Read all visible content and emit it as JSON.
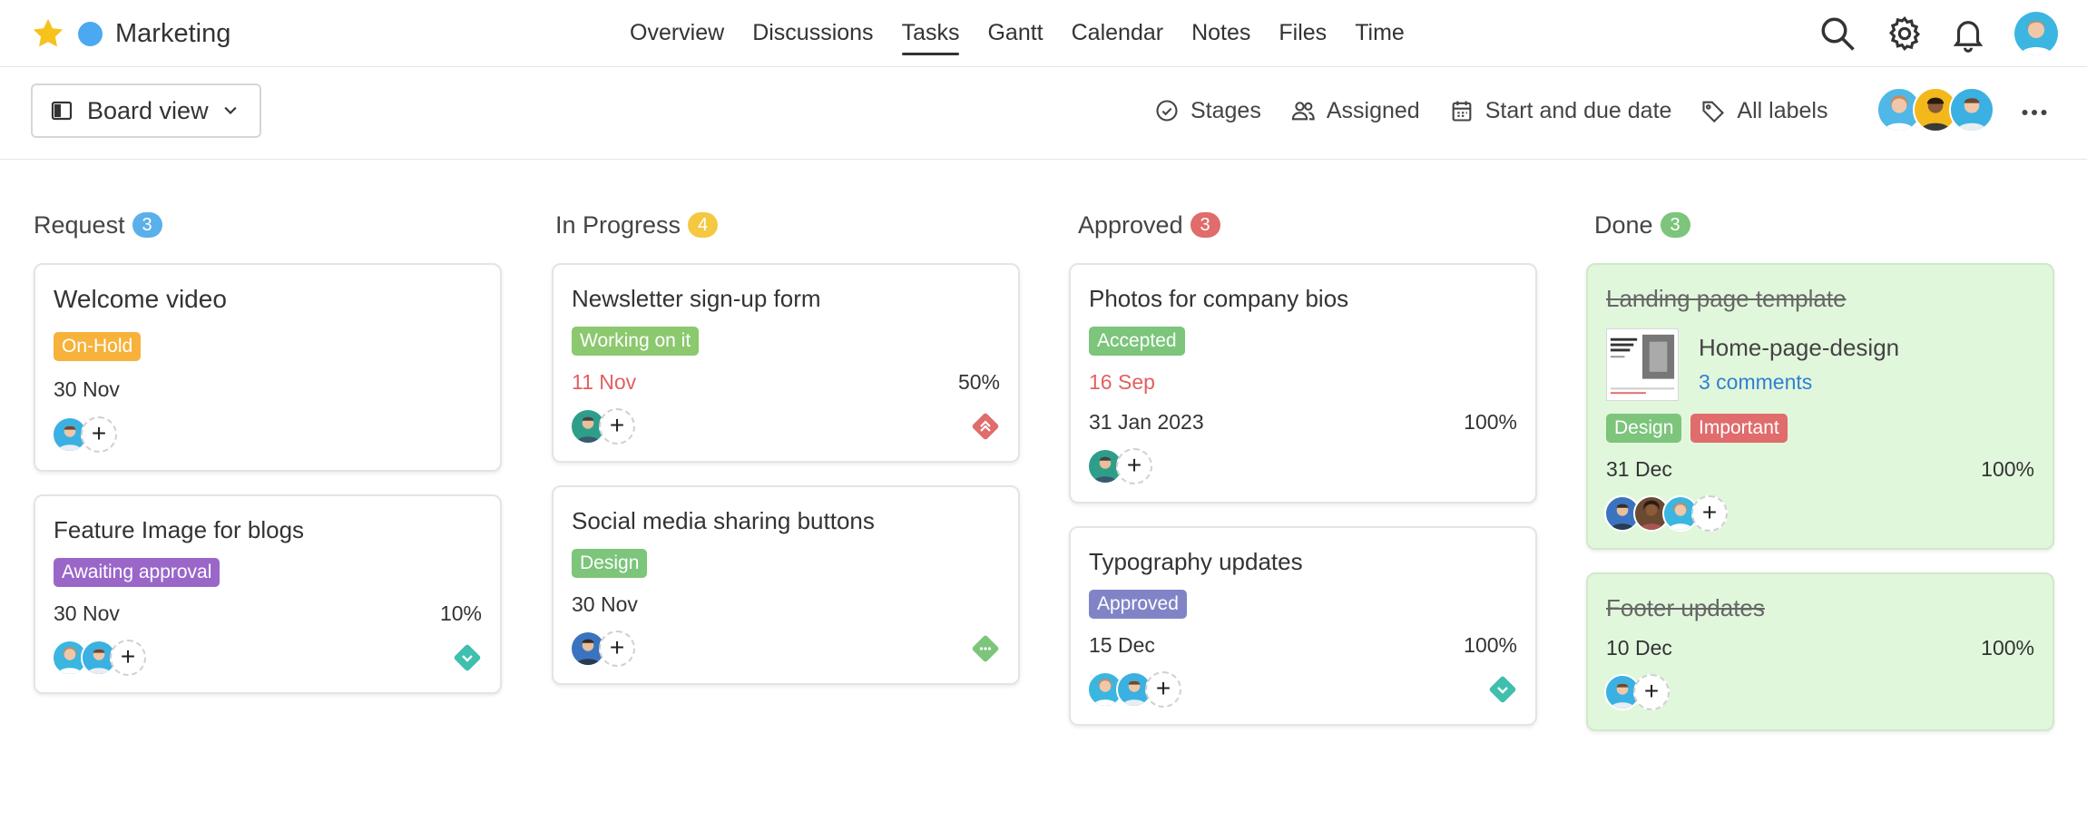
{
  "project": {
    "name": "Marketing",
    "dot_color": "#4aa9f0",
    "star_color": "#f7c21b"
  },
  "nav": {
    "tabs": [
      {
        "label": "Overview",
        "active": false
      },
      {
        "label": "Discussions",
        "active": false
      },
      {
        "label": "Tasks",
        "active": true
      },
      {
        "label": "Gantt",
        "active": false
      },
      {
        "label": "Calendar",
        "active": false
      },
      {
        "label": "Notes",
        "active": false
      },
      {
        "label": "Files",
        "active": false
      },
      {
        "label": "Time",
        "active": false
      }
    ],
    "icons": [
      "search-icon",
      "gear-icon",
      "bell-icon",
      "user-avatar"
    ]
  },
  "toolbar": {
    "view_label": "Board view",
    "filters": {
      "stages": "Stages",
      "assigned": "Assigned",
      "dates": "Start and due date",
      "labels": "All labels"
    }
  },
  "colors": {
    "request": "#5ab0ea",
    "in_progress": "#f5c842",
    "approved": "#e06c6c",
    "done": "#7cc57b",
    "onhold": "#f7b23b",
    "working": "#8cc86e",
    "awaiting": "#9a67c9",
    "design": "#7cc57b",
    "accepted": "#7cc57b",
    "approved_label": "#8084c7",
    "important": "#e06c6c",
    "done_card": "#e1f7dc"
  },
  "columns": [
    {
      "title": "Request",
      "count": "3",
      "cards": [
        {
          "title": "Welcome video",
          "label": "On-Hold",
          "date": "30 Nov"
        },
        {
          "title": "Feature Image for blogs",
          "label": "Awaiting approval",
          "date": "30 Nov",
          "progress": "10%"
        }
      ]
    },
    {
      "title": "In Progress",
      "count": "4",
      "cards": [
        {
          "title": "Newsletter sign-up form",
          "label": "Working on it",
          "date": "11 Nov",
          "progress": "50%"
        },
        {
          "title": "Social media sharing buttons",
          "label": "Design",
          "date": "30 Nov"
        }
      ]
    },
    {
      "title": "Approved",
      "count": "3",
      "cards": [
        {
          "title": "Photos for company bios",
          "label": "Accepted",
          "date": "16 Sep",
          "date2": "31 Jan 2023",
          "progress": "100%"
        },
        {
          "title": "Typography updates",
          "label": "Approved",
          "date": "15 Dec",
          "progress": "100%"
        }
      ]
    },
    {
      "title": "Done",
      "count": "3",
      "cards": [
        {
          "title": "Landing page template",
          "attachment": "Home-page-design",
          "comments": "3 comments",
          "labels": [
            "Design",
            "Important"
          ],
          "date": "31 Dec",
          "progress": "100%"
        },
        {
          "title": "Footer updates",
          "date": "10 Dec",
          "progress": "100%"
        }
      ]
    }
  ],
  "add_label": "+"
}
